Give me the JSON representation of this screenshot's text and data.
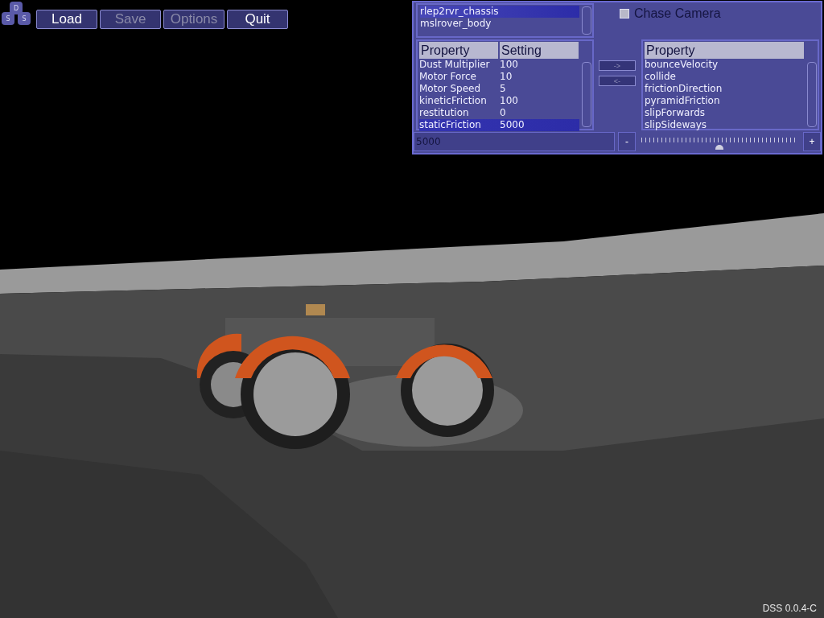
{
  "logo": {
    "letters": [
      "D",
      "S",
      "S"
    ]
  },
  "menu": [
    {
      "label": "Load",
      "disabled": false
    },
    {
      "label": "Save",
      "disabled": true
    },
    {
      "label": "Options",
      "disabled": true
    },
    {
      "label": "Quit",
      "disabled": false
    }
  ],
  "bodies": [
    {
      "label": "rlep2rvr_chassis",
      "selected": true
    },
    {
      "label": "mslrover_body",
      "selected": false
    }
  ],
  "chase_camera": {
    "label": "Chase Camera",
    "checked": false
  },
  "properties_table": {
    "columns": [
      "Property",
      "Setting"
    ],
    "rows": [
      {
        "property": "Dust Multiplier",
        "setting": "100",
        "selected": false
      },
      {
        "property": "Motor Force",
        "setting": "10",
        "selected": false
      },
      {
        "property": "Motor Speed",
        "setting": "5",
        "selected": false
      },
      {
        "property": "kineticFriction",
        "setting": "100",
        "selected": false
      },
      {
        "property": "restitution",
        "setting": "0",
        "selected": false
      },
      {
        "property": "staticFriction",
        "setting": "5000",
        "selected": true
      }
    ]
  },
  "transfer_buttons": [
    {
      "label": "->"
    },
    {
      "label": "<-"
    }
  ],
  "available_properties": {
    "column": "Property",
    "items": [
      "bounceVelocity",
      "collide",
      "frictionDirection",
      "pyramidFriction",
      "slipForwards",
      "slipSideways"
    ]
  },
  "value_field": {
    "value": "5000"
  },
  "decrement": "-",
  "slider": {
    "level": 0.5
  },
  "increment": "+",
  "version": "DSS 0.0.4-C"
}
